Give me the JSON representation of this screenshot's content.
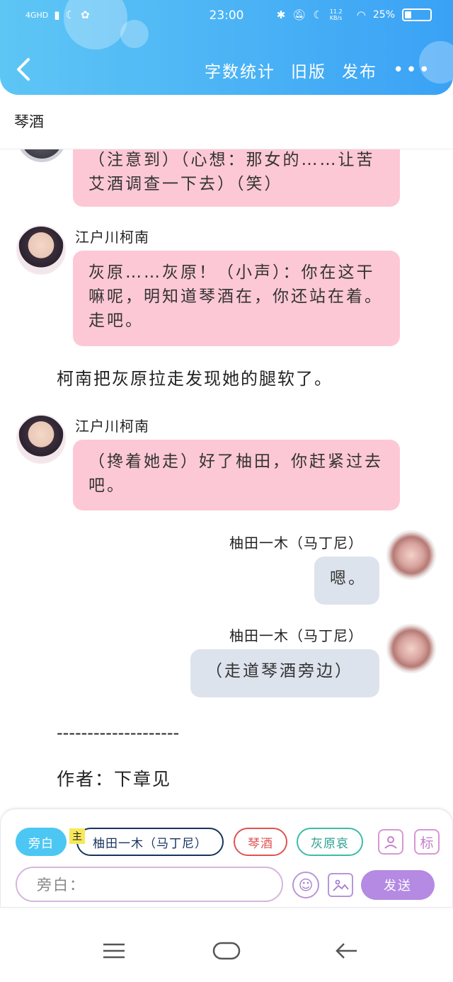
{
  "status_bar": {
    "network": "4GHD",
    "time": "23:00",
    "speed": "11.2 KB/s",
    "battery": "25%",
    "battery_level": 0.25
  },
  "header": {
    "back_icon": "chevron-left-icon",
    "actions": [
      "字数统计",
      "旧版",
      "发布"
    ],
    "more_icon": "more-dots-icon"
  },
  "document": {
    "title": "琴酒"
  },
  "messages": {
    "m1": {
      "text": "（注意到）（心想：那女的……让苦艾酒调查一下去）（笑）"
    },
    "m2": {
      "speaker": "江户川柯南",
      "text": "灰原……灰原！（小声）：你在这干嘛呢，明知道琴酒在，你还站在着。走吧。"
    },
    "n1": {
      "text": "柯南把灰原拉走发现她的腿软了。"
    },
    "m3": {
      "speaker": "江户川柯南",
      "text": "（搀着她走）好了柚田，你赶紧过去吧。"
    },
    "m4": {
      "speaker": "柚田一木（马丁尼）",
      "text": "嗯。"
    },
    "m5": {
      "speaker": "柚田一木（马丁尼）",
      "text": "（走道琴酒旁边）"
    },
    "divider": "--------------------",
    "footer": "作者：下章见"
  },
  "input_panel": {
    "chips": [
      "旁白",
      "柚田一木（马丁尼）",
      "琴酒",
      "灰原哀"
    ],
    "host_tag": "主",
    "character_icon": "person-card-icon",
    "tag_label": "标",
    "placeholder": "旁白：",
    "emoji_icon": "smile-icon",
    "image_icon": "image-icon",
    "send": "发送"
  },
  "system_nav": {
    "menu_icon": "menu-icon",
    "home_icon": "home-icon",
    "back_icon": "back-arrow-icon"
  }
}
